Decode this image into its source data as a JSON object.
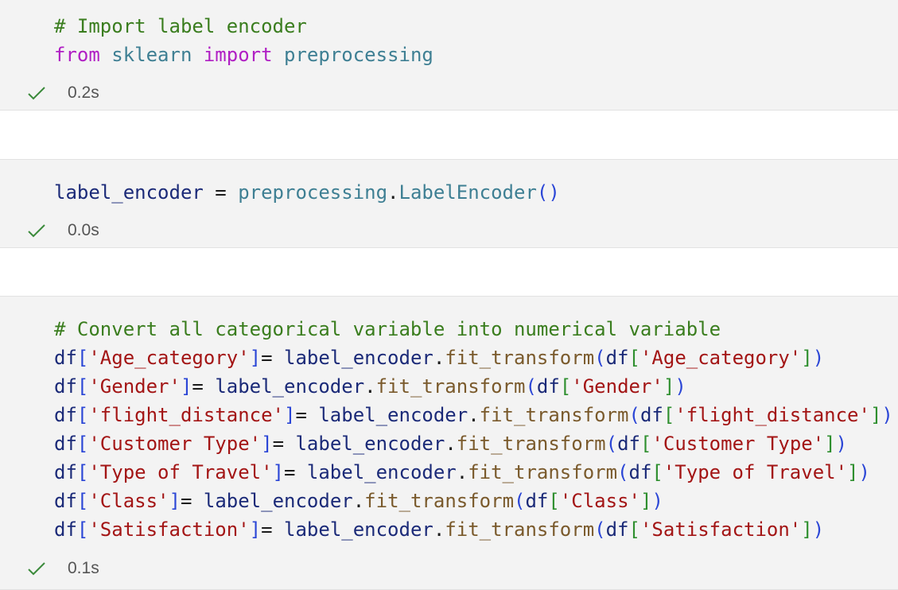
{
  "cells": [
    {
      "lines": [
        [
          {
            "t": "# Import label encoder",
            "c": "c-comment"
          }
        ],
        [
          {
            "t": "from",
            "c": "c-keyword"
          },
          {
            "t": " ",
            "c": "c-punc"
          },
          {
            "t": "sklearn",
            "c": "c-module"
          },
          {
            "t": " ",
            "c": "c-punc"
          },
          {
            "t": "import",
            "c": "c-keyword"
          },
          {
            "t": " ",
            "c": "c-punc"
          },
          {
            "t": "preprocessing",
            "c": "c-module"
          }
        ]
      ],
      "status": "0.2s"
    },
    {
      "lines": [
        [
          {
            "t": "label_encoder",
            "c": "c-var"
          },
          {
            "t": " = ",
            "c": "c-punc"
          },
          {
            "t": "preprocessing",
            "c": "c-module"
          },
          {
            "t": ".",
            "c": "c-punc"
          },
          {
            "t": "LabelEncoder",
            "c": "c-cls"
          },
          {
            "t": "()",
            "c": "c-bracket1"
          }
        ]
      ],
      "status": "0.0s"
    },
    {
      "lines": [
        [
          {
            "t": "# Convert all categorical variable into numerical variable",
            "c": "c-comment"
          }
        ],
        [
          {
            "t": "df",
            "c": "c-var"
          },
          {
            "t": "[",
            "c": "c-bracket1"
          },
          {
            "t": "'Age_category'",
            "c": "c-str"
          },
          {
            "t": "]",
            "c": "c-bracket1"
          },
          {
            "t": "= ",
            "c": "c-punc"
          },
          {
            "t": "label_encoder",
            "c": "c-var"
          },
          {
            "t": ".",
            "c": "c-punc"
          },
          {
            "t": "fit_transform",
            "c": "c-func"
          },
          {
            "t": "(",
            "c": "c-bracket1"
          },
          {
            "t": "df",
            "c": "c-var"
          },
          {
            "t": "[",
            "c": "c-bracket2"
          },
          {
            "t": "'Age_category'",
            "c": "c-str"
          },
          {
            "t": "]",
            "c": "c-bracket2"
          },
          {
            "t": ")",
            "c": "c-bracket1"
          }
        ],
        [
          {
            "t": "df",
            "c": "c-var"
          },
          {
            "t": "[",
            "c": "c-bracket1"
          },
          {
            "t": "'Gender'",
            "c": "c-str"
          },
          {
            "t": "]",
            "c": "c-bracket1"
          },
          {
            "t": "= ",
            "c": "c-punc"
          },
          {
            "t": "label_encoder",
            "c": "c-var"
          },
          {
            "t": ".",
            "c": "c-punc"
          },
          {
            "t": "fit_transform",
            "c": "c-func"
          },
          {
            "t": "(",
            "c": "c-bracket1"
          },
          {
            "t": "df",
            "c": "c-var"
          },
          {
            "t": "[",
            "c": "c-bracket2"
          },
          {
            "t": "'Gender'",
            "c": "c-str"
          },
          {
            "t": "]",
            "c": "c-bracket2"
          },
          {
            "t": ")",
            "c": "c-bracket1"
          }
        ],
        [
          {
            "t": "df",
            "c": "c-var"
          },
          {
            "t": "[",
            "c": "c-bracket1"
          },
          {
            "t": "'flight_distance'",
            "c": "c-str"
          },
          {
            "t": "]",
            "c": "c-bracket1"
          },
          {
            "t": "= ",
            "c": "c-punc"
          },
          {
            "t": "label_encoder",
            "c": "c-var"
          },
          {
            "t": ".",
            "c": "c-punc"
          },
          {
            "t": "fit_transform",
            "c": "c-func"
          },
          {
            "t": "(",
            "c": "c-bracket1"
          },
          {
            "t": "df",
            "c": "c-var"
          },
          {
            "t": "[",
            "c": "c-bracket2"
          },
          {
            "t": "'flight_distance'",
            "c": "c-str"
          },
          {
            "t": "]",
            "c": "c-bracket2"
          },
          {
            "t": ")",
            "c": "c-bracket1"
          }
        ],
        [
          {
            "t": "df",
            "c": "c-var"
          },
          {
            "t": "[",
            "c": "c-bracket1"
          },
          {
            "t": "'Customer Type'",
            "c": "c-str"
          },
          {
            "t": "]",
            "c": "c-bracket1"
          },
          {
            "t": "= ",
            "c": "c-punc"
          },
          {
            "t": "label_encoder",
            "c": "c-var"
          },
          {
            "t": ".",
            "c": "c-punc"
          },
          {
            "t": "fit_transform",
            "c": "c-func"
          },
          {
            "t": "(",
            "c": "c-bracket1"
          },
          {
            "t": "df",
            "c": "c-var"
          },
          {
            "t": "[",
            "c": "c-bracket2"
          },
          {
            "t": "'Customer Type'",
            "c": "c-str"
          },
          {
            "t": "]",
            "c": "c-bracket2"
          },
          {
            "t": ")",
            "c": "c-bracket1"
          }
        ],
        [
          {
            "t": "df",
            "c": "c-var"
          },
          {
            "t": "[",
            "c": "c-bracket1"
          },
          {
            "t": "'Type of Travel'",
            "c": "c-str"
          },
          {
            "t": "]",
            "c": "c-bracket1"
          },
          {
            "t": "= ",
            "c": "c-punc"
          },
          {
            "t": "label_encoder",
            "c": "c-var"
          },
          {
            "t": ".",
            "c": "c-punc"
          },
          {
            "t": "fit_transform",
            "c": "c-func"
          },
          {
            "t": "(",
            "c": "c-bracket1"
          },
          {
            "t": "df",
            "c": "c-var"
          },
          {
            "t": "[",
            "c": "c-bracket2"
          },
          {
            "t": "'Type of Travel'",
            "c": "c-str"
          },
          {
            "t": "]",
            "c": "c-bracket2"
          },
          {
            "t": ")",
            "c": "c-bracket1"
          }
        ],
        [
          {
            "t": "df",
            "c": "c-var"
          },
          {
            "t": "[",
            "c": "c-bracket1"
          },
          {
            "t": "'Class'",
            "c": "c-str"
          },
          {
            "t": "]",
            "c": "c-bracket1"
          },
          {
            "t": "= ",
            "c": "c-punc"
          },
          {
            "t": "label_encoder",
            "c": "c-var"
          },
          {
            "t": ".",
            "c": "c-punc"
          },
          {
            "t": "fit_transform",
            "c": "c-func"
          },
          {
            "t": "(",
            "c": "c-bracket1"
          },
          {
            "t": "df",
            "c": "c-var"
          },
          {
            "t": "[",
            "c": "c-bracket2"
          },
          {
            "t": "'Class'",
            "c": "c-str"
          },
          {
            "t": "]",
            "c": "c-bracket2"
          },
          {
            "t": ")",
            "c": "c-bracket1"
          }
        ],
        [
          {
            "t": "df",
            "c": "c-var"
          },
          {
            "t": "[",
            "c": "c-bracket1"
          },
          {
            "t": "'Satisfaction'",
            "c": "c-str"
          },
          {
            "t": "]",
            "c": "c-bracket1"
          },
          {
            "t": "= ",
            "c": "c-punc"
          },
          {
            "t": "label_encoder",
            "c": "c-var"
          },
          {
            "t": ".",
            "c": "c-punc"
          },
          {
            "t": "fit_transform",
            "c": "c-func"
          },
          {
            "t": "(",
            "c": "c-bracket1"
          },
          {
            "t": "df",
            "c": "c-var"
          },
          {
            "t": "[",
            "c": "c-bracket2"
          },
          {
            "t": "'Satisfaction'",
            "c": "c-str"
          },
          {
            "t": "]",
            "c": "c-bracket2"
          },
          {
            "t": ")",
            "c": "c-bracket1"
          }
        ]
      ],
      "status": "0.1s"
    }
  ],
  "icons": {
    "status_icon": "check-icon",
    "check_color": "#3a8a3a"
  }
}
